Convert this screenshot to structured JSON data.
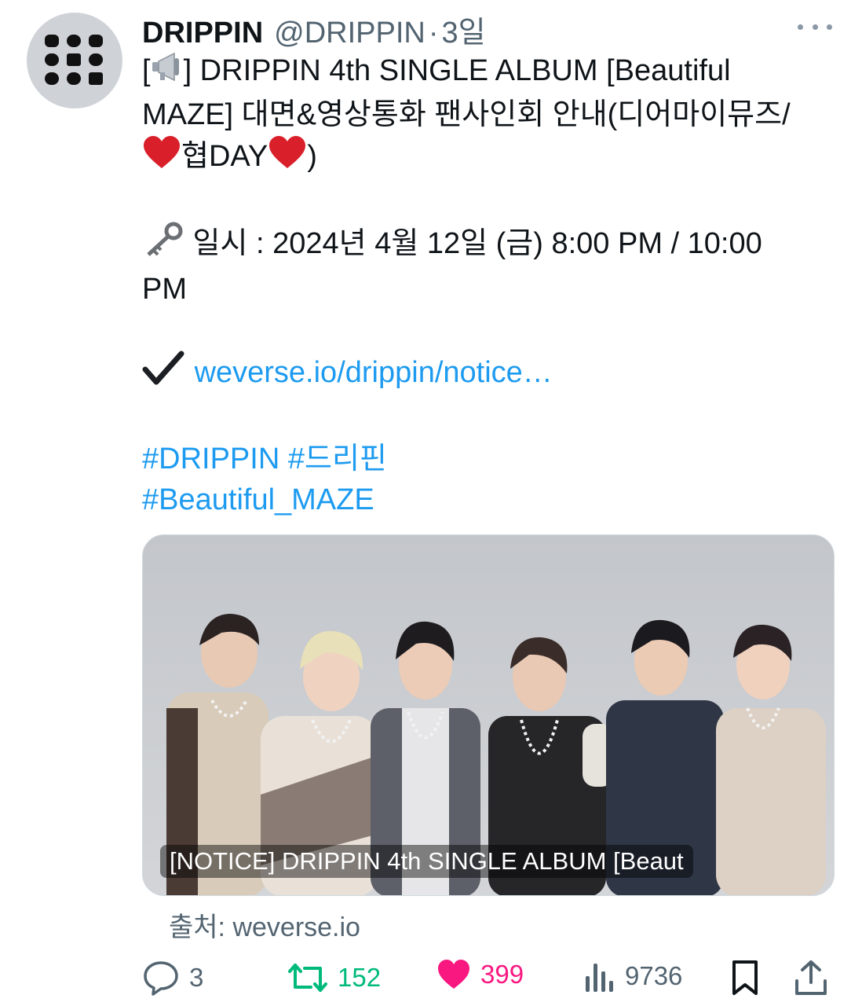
{
  "tweet": {
    "author_name": "DRIPPIN",
    "handle": "@DRIPPIN",
    "separator": "·",
    "time": "3일",
    "line1": "] DRIPPIN 4th SINGLE ALBUM [Beautiful",
    "line1_prefix": "[",
    "line2": "MAZE] 대면&영상통화 팬사인회 안내(디어마이뮤즈/",
    "line3": "협DAY",
    "line3_suffix": ")",
    "date_line": " 일시 : 2024년 4월 12일 (금) 8:00 PM / 10:00",
    "date_line2": "PM",
    "link_text": "weverse.io/drippin/notice…",
    "hashtag1": "#DRIPPIN",
    "hashtag2": "#드리핀",
    "hashtag3": "#Beautiful_MAZE"
  },
  "card": {
    "title": "[NOTICE] DRIPPIN 4th SINGLE ALBUM [Beaut",
    "source": "출처: weverse.io"
  },
  "actions": {
    "replies": "3",
    "retweets": "152",
    "likes": "399",
    "views": "9736"
  },
  "colors": {
    "link": "#1d9bf0",
    "retweet": "#00ba7c",
    "like": "#f91880",
    "muted": "#536471"
  },
  "icons": [
    "avatar-logo",
    "more-icon",
    "megaphone-icon",
    "heart-icon",
    "key-icon",
    "check-icon",
    "reply-icon",
    "retweet-icon",
    "like-icon",
    "views-icon",
    "bookmark-icon",
    "share-icon"
  ]
}
